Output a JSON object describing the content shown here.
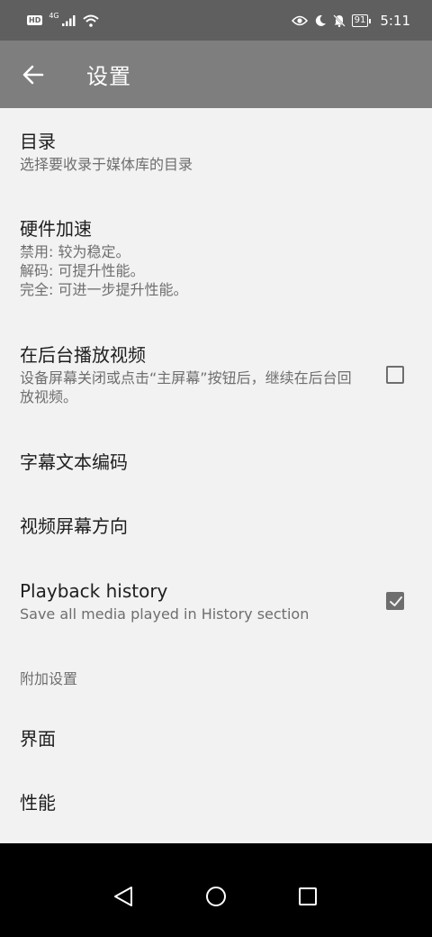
{
  "status_bar": {
    "hd": "HD",
    "network": "4G",
    "battery": "91",
    "time": "5:11"
  },
  "app_bar": {
    "title": "设置"
  },
  "settings": {
    "directories": {
      "title": "目录",
      "subtitle": "选择要收录于媒体库的目录"
    },
    "hw_accel": {
      "title": "硬件加速",
      "subtitle": "禁用: 较为稳定。\n解码: 可提升性能。\n完全: 可进一步提升性能。"
    },
    "background_play": {
      "title": "在后台播放视频",
      "subtitle": "设备屏幕关闭或点击“主屏幕”按钮后，继续在后台回放视频。",
      "checked": false
    },
    "subtitle_encoding": {
      "title": "字幕文本编码"
    },
    "screen_orientation": {
      "title": "视频屏幕方向"
    },
    "playback_history": {
      "title": "Playback history",
      "subtitle": "Save all media played in History section",
      "checked": true
    }
  },
  "extra_section": {
    "header": "附加设置",
    "interface": {
      "title": "界面"
    },
    "performance": {
      "title": "性能"
    }
  },
  "colors": {
    "app_bar": "#7e7e7e",
    "status_bar": "#5f5f5f",
    "background": "#f2f2f2",
    "accent": "#6e6e6e"
  }
}
